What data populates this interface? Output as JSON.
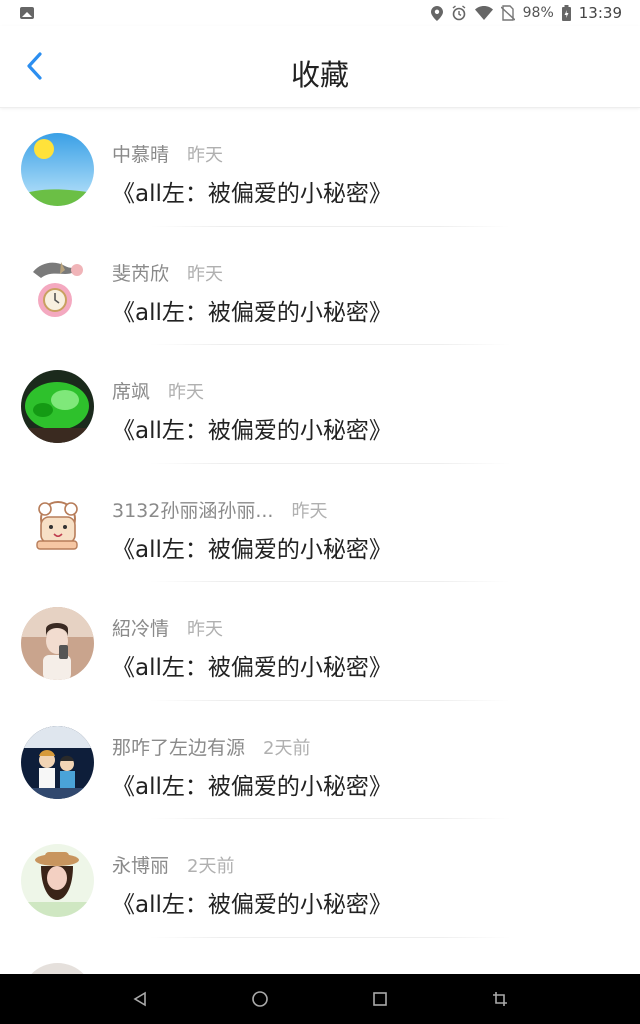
{
  "status_bar": {
    "battery": "98%",
    "time": "13:39"
  },
  "header": {
    "title": "收藏"
  },
  "items": [
    {
      "name": "中慕晴",
      "time": "昨天",
      "book": "《all左：被偏爱的小秘密》"
    },
    {
      "name": "斐芮欣",
      "time": "昨天",
      "book": "《all左：被偏爱的小秘密》"
    },
    {
      "name": "席飒",
      "time": "昨天",
      "book": "《all左：被偏爱的小秘密》"
    },
    {
      "name": "3132孙丽涵孙丽...",
      "time": "昨天",
      "book": "《all左：被偏爱的小秘密》"
    },
    {
      "name": "紹冷情",
      "time": "昨天",
      "book": "《all左：被偏爱的小秘密》"
    },
    {
      "name": "那咋了左边有源",
      "time": "2天前",
      "book": "《all左：被偏爱的小秘密》"
    },
    {
      "name": "永博丽",
      "time": "2天前",
      "book": "《all左：被偏爱的小秘密》"
    }
  ],
  "colors": {
    "accent": "#2b8ef0",
    "name": "#8a8a8a",
    "time": "#b0b0b0"
  }
}
